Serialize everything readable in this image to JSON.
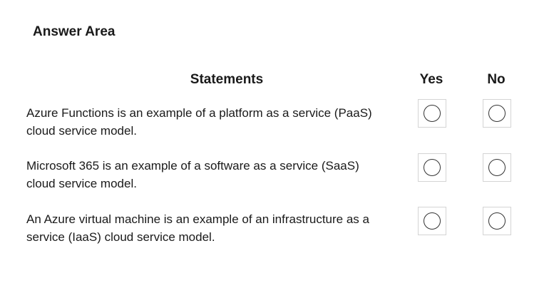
{
  "page": {
    "title": "Answer Area"
  },
  "table": {
    "headers": {
      "statements": "Statements",
      "yes": "Yes",
      "no": "No"
    },
    "rows": [
      {
        "line1": "Azure Functions is an example of a platform as a service (PaaS)",
        "line2": "cloud service model.",
        "yes_selected": false,
        "no_selected": false
      },
      {
        "line1": "Microsoft 365 is an example of a software as a service (SaaS)",
        "line2": "cloud service model.",
        "yes_selected": false,
        "no_selected": false
      },
      {
        "line1": "An Azure virtual machine is an example of an infrastructure as a",
        "line2": "service (IaaS) cloud service model.",
        "yes_selected": false,
        "no_selected": false
      }
    ]
  }
}
